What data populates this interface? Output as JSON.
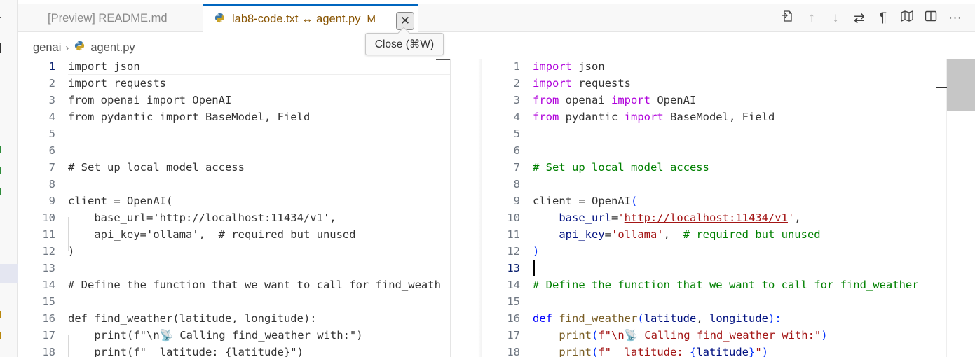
{
  "tabs": [
    {
      "label": "[Preview] README.md",
      "active": false
    },
    {
      "label": "lab8-code.txt ↔ agent.py",
      "modified_badge": "M",
      "active": true
    }
  ],
  "tooltip": "Close (⌘W)",
  "breadcrumb": {
    "folder": "genai",
    "file": "agent.py"
  },
  "colors": {
    "keyword": "#af00db",
    "comment": "#008000",
    "string": "#a31515",
    "active_tab_border": "#0066bf",
    "modified": "#895503"
  },
  "actions": [
    "open-changes-icon",
    "previous-change-icon",
    "next-change-icon",
    "swap-sides-icon",
    "show-whitespace-icon",
    "toggle-inline-view-icon",
    "split-editor-icon",
    "more-actions-icon"
  ],
  "line_numbers": [
    "1",
    "2",
    "3",
    "4",
    "5",
    "6",
    "7",
    "8",
    "9",
    "10",
    "11",
    "12",
    "13",
    "14",
    "15",
    "16",
    "17",
    "18"
  ],
  "left_lines": [
    "import json",
    "import requests",
    "from openai import OpenAI",
    "from pydantic import BaseModel, Field",
    "",
    "",
    "# Set up local model access",
    "",
    "client = OpenAI(",
    "    base_url='http://localhost:11434/v1',",
    "    api_key='ollama',  # required but unused",
    ")",
    "",
    "# Define the function that we want to call for find_weath",
    "",
    "def find_weather(latitude, longitude):",
    "    print(f\"\\n📡 Calling find_weather with:\")",
    "    print(f\"  latitude: {latitude}\")"
  ],
  "right_lines": {
    "l1a": "import",
    "l1b": " json",
    "l2a": "import",
    "l2b": " requests",
    "l3a": "from",
    "l3b": " openai ",
    "l3c": "import",
    "l3d": " OpenAI",
    "l4a": "from",
    "l4b": " pydantic ",
    "l4c": "import",
    "l4d": " BaseModel, Field",
    "l7": "# Set up local model access",
    "l9a": "client",
    "l9b": " = ",
    "l9c": "OpenAI",
    "l9d": "(",
    "l10a": "    base_url",
    "l10b": "=",
    "l10c": "'",
    "l10d": "http://localhost:11434/v1",
    "l10e": "'",
    "l10f": ",",
    "l11a": "    api_key",
    "l11b": "=",
    "l11c": "'ollama'",
    "l11d": ",  ",
    "l11e": "# required but unused",
    "l12": ")",
    "l14": "# Define the function that we want to call for find_weather",
    "l16a": "def",
    "l16b": " find_weather",
    "l16c": "(",
    "l16d": "latitude",
    "l16e": ", ",
    "l16f": "longitude",
    "l16g": "):",
    "l17a": "    print",
    "l17b": "(",
    "l17c": "f\"\\n📡 Calling find_weather with:\"",
    "l17d": ")",
    "l18a": "    print",
    "l18b": "(",
    "l18c": "f\"  latitude: ",
    "l18d": "{",
    "l18e": "latitude",
    "l18f": "}",
    "l18g": "\"",
    "l18h": ")"
  }
}
